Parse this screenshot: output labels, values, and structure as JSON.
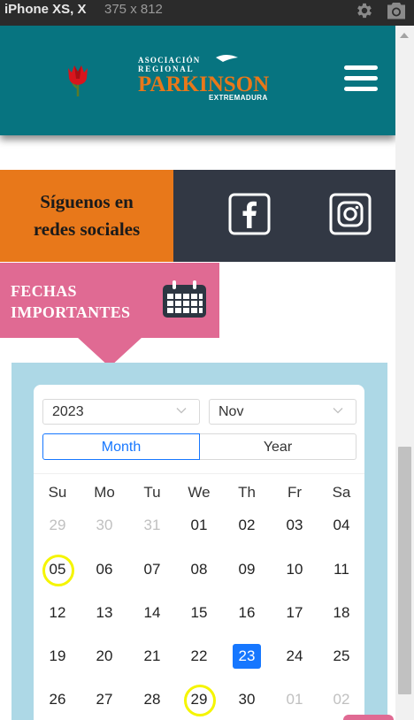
{
  "devtools": {
    "device": "iPhone XS, X",
    "dimensions": "375  x  812"
  },
  "header": {
    "logo_line1": "ASOCIACIÓN",
    "logo_line2": "REGIONAL",
    "logo_main": "PARKINSON",
    "logo_sub": "EXTREMADURA",
    "brand_color": "#077480",
    "logo_color": "#e8781a"
  },
  "social": {
    "follow_line1": "Síguenos en",
    "follow_line2": "redes sociales",
    "networks": [
      "facebook",
      "instagram"
    ]
  },
  "important_dates": {
    "line1": "FECHAS",
    "line2": "IMPORTANTES",
    "color": "#e06a93"
  },
  "calendar": {
    "year": "2023",
    "month": "Nov",
    "mode_month": "Month",
    "mode_year": "Year",
    "weekdays": [
      "Su",
      "Mo",
      "Tu",
      "We",
      "Th",
      "Fr",
      "Sa"
    ],
    "weeks": [
      [
        "29",
        "30",
        "31",
        "01",
        "02",
        "03",
        "04"
      ],
      [
        "05",
        "06",
        "07",
        "08",
        "09",
        "10",
        "11"
      ],
      [
        "12",
        "13",
        "14",
        "15",
        "16",
        "17",
        "18"
      ],
      [
        "19",
        "20",
        "21",
        "22",
        "23",
        "24",
        "25"
      ],
      [
        "26",
        "27",
        "28",
        "29",
        "30",
        "01",
        "02"
      ]
    ],
    "selected_day": "23",
    "circled_days": [
      "05",
      "29"
    ],
    "background": "#add8e6",
    "accent": "#1677ff"
  }
}
